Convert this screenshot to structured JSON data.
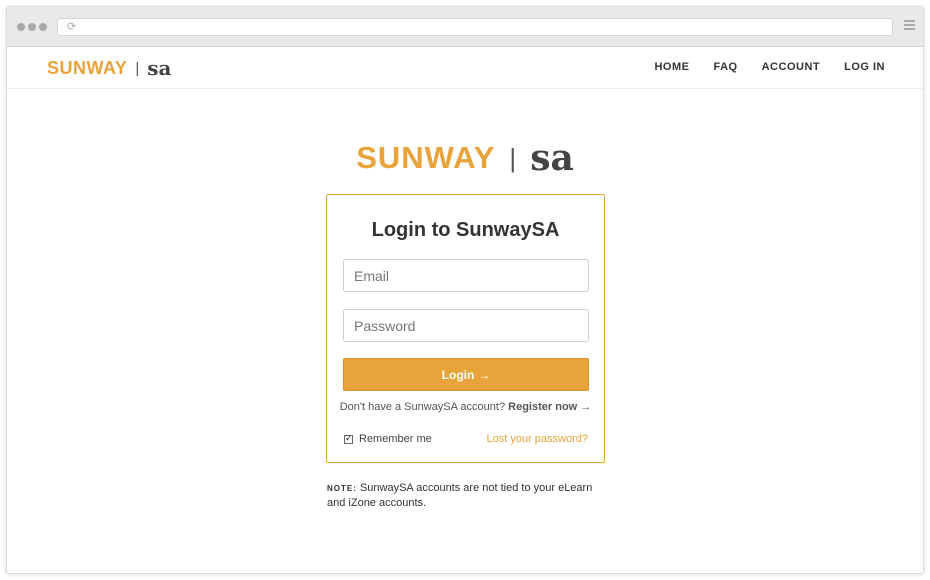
{
  "nav": {
    "home": "HOME",
    "faq": "FAQ",
    "account": "ACCOUNT",
    "login": "LOG IN"
  },
  "logo": {
    "brand": "SUNWAY",
    "separator": "|",
    "sa": "sa"
  },
  "card": {
    "title": "Login to SunwaySA",
    "email_placeholder": "Email",
    "password_placeholder": "Password",
    "login_label": "Login",
    "login_icon": "→",
    "register_prompt": "Don't have a SunwaySA account?",
    "register_link": "Register now →",
    "remember_label": "Remember me",
    "lost_password": "Lost your password?"
  },
  "note": {
    "label": "NOTE:",
    "text": "SunwaySA accounts are not tied to your eLearn and iZone accounts."
  },
  "colors": {
    "accent": "#e8a33b",
    "text": "#333333"
  },
  "icons": [
    "reload-icon",
    "menu-icon",
    "arrow-right-icon",
    "checkbox-checked-icon"
  ]
}
